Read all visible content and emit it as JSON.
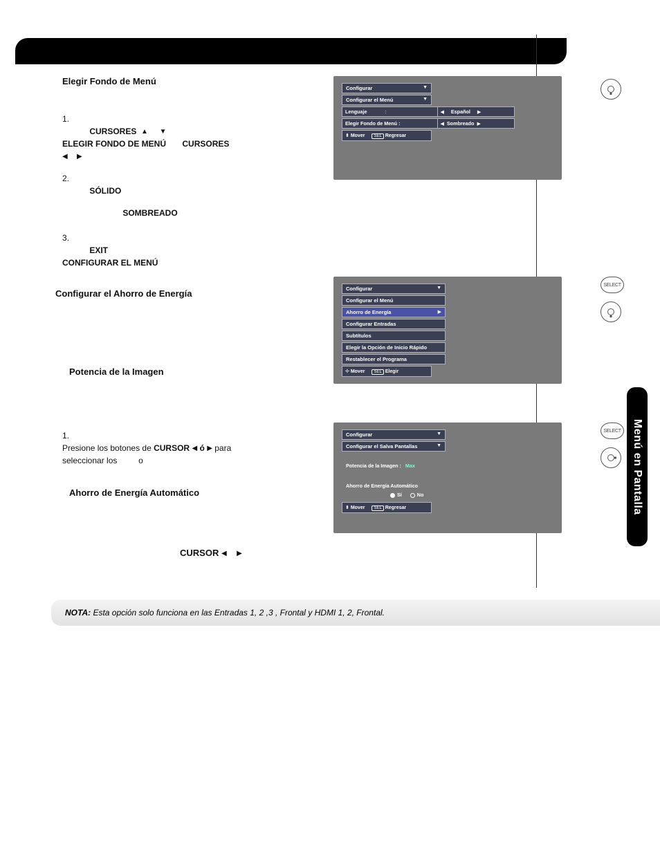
{
  "side_tab": "Menú en Pantalla",
  "section1": {
    "title": "Elegir Fondo de Menú",
    "steps": {
      "s1": {
        "num": "1.",
        "pre": "",
        "cursores": "CURSORES",
        "up": "▲",
        "down": "▼",
        "line2a": "ELEGIR FONDO DE MENÚ",
        "line2b": "CURSORES",
        "left": "◀",
        "right": "▶"
      },
      "s2": {
        "num": "2.",
        "solido": "SÓLIDO",
        "sombreado": "SOMBREADO"
      },
      "s3": {
        "num": "3.",
        "exit": "EXIT",
        "conf": "CONFIGURAR EL MENÚ"
      }
    }
  },
  "section2": {
    "title": "Configurar el  Ahorro de Energía",
    "sub_potencia": "Potencia de la Imagen",
    "step1": {
      "num": "1.",
      "prefix": "Presione los botones de ",
      "cursor": "CURSOR",
      "left": "◀",
      "o": "ó",
      "right": "▶",
      "suffix": " para",
      "line2a": "seleccionar los ",
      "line2b": "o"
    },
    "sub_ahorro": "Ahorro de Energía Automático",
    "cursor_lr": {
      "label": "CURSOR",
      "left": "◀",
      "right": "▶"
    }
  },
  "osd1": {
    "title": "Configurar",
    "sub": "Configurar el Menú",
    "row1_l": "Lenguaje",
    "row1_colon": ":",
    "row1_r": "Español",
    "row2_l": "Elegir Fondo de Menú :",
    "row2_r": "Sombreado",
    "help_move": "Mover",
    "help_sel": "SEL",
    "help_back": "Regresar",
    "up": "▲",
    "down": "▼",
    "left": "◀",
    "right": "▶",
    "ud": "⬍"
  },
  "osd2": {
    "title": "Configurar",
    "items": {
      "a": "Configurar el Menú",
      "b": "Ahorro de Energía",
      "c": "Configurar Entradas",
      "d": "Subtítulos",
      "e": "Elegir la Opción de Inicio Rápido",
      "f": "Restablecer el Programa"
    },
    "help_move": "Mover",
    "help_sel": "SEL",
    "help_pick": "Elegir",
    "cross": "✢",
    "right": "▶",
    "down": "▼"
  },
  "osd3": {
    "title": "Configurar",
    "sub": "Configurar el Salva Pantallas",
    "row1_l": "Potencia de la Imagen   :",
    "row1_r": "Max",
    "heading": "Ahorro de Energía Automático",
    "opt_yes": "Sí",
    "opt_no": "No",
    "help_move": "Mover",
    "help_sel": "SEL",
    "help_back": "Regresar",
    "ud": "⬍",
    "down": "▼"
  },
  "note": {
    "label": "NOTA:",
    "text": " Esta opción solo funciona en las Entradas 1, 2 ,3 , Frontal y HDMI 1, 2, Frontal."
  },
  "remote": {
    "select": "SELECT"
  }
}
